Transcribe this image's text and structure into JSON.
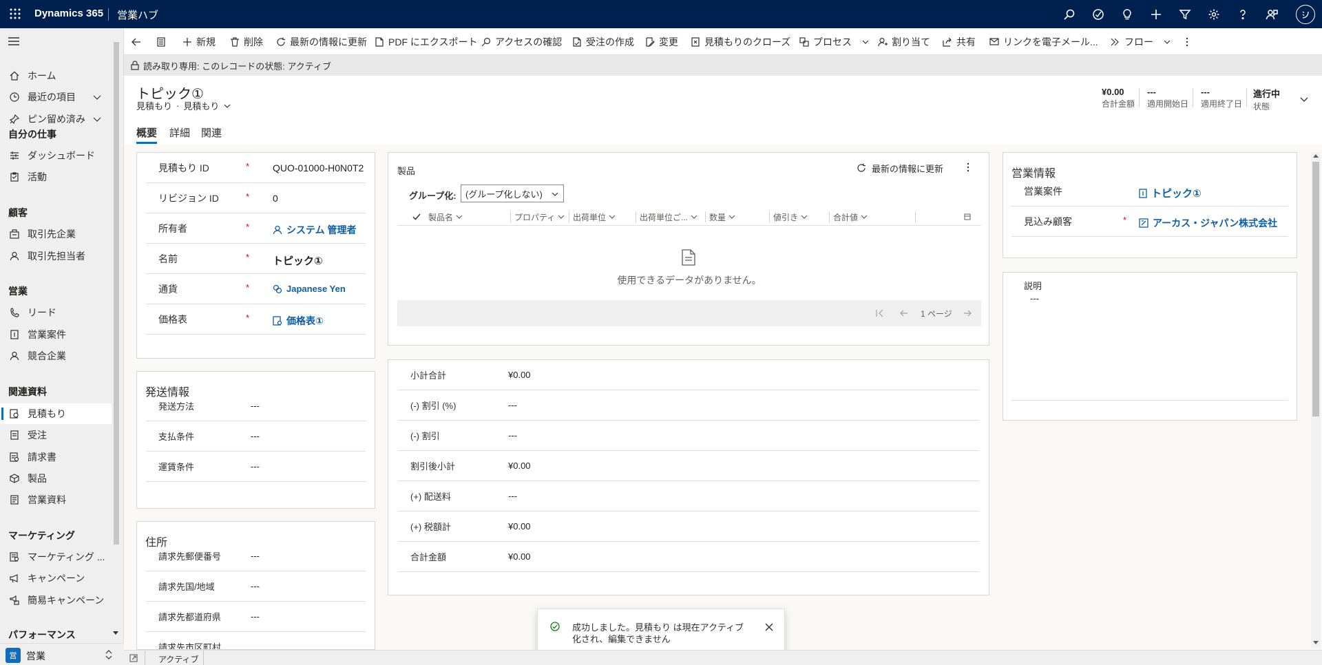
{
  "topbar": {
    "brand": "Dynamics 365",
    "app_name": "営業ハブ"
  },
  "nav": {
    "items": [
      {
        "label": "ホーム"
      },
      {
        "label": "最近の項目"
      },
      {
        "label": "ピン留め済み"
      }
    ],
    "groups": {
      "my_work": "自分の仕事",
      "customers": "顧客",
      "sales": "営業",
      "collateral": "関連資料",
      "marketing": "マーケティング",
      "performance": "パフォーマンス"
    },
    "my_work_items": [
      {
        "label": "ダッシュボード"
      },
      {
        "label": "活動"
      }
    ],
    "customer_items": [
      {
        "label": "取引先企業"
      },
      {
        "label": "取引先担当者"
      }
    ],
    "sales_items": [
      {
        "label": "リード"
      },
      {
        "label": "営業案件"
      },
      {
        "label": "競合企業"
      }
    ],
    "collateral_items": [
      {
        "label": "見積もり"
      },
      {
        "label": "受注"
      },
      {
        "label": "請求書"
      },
      {
        "label": "製品"
      },
      {
        "label": "営業資料"
      }
    ],
    "marketing_items": [
      {
        "label": "マーケティング ..."
      },
      {
        "label": "キャンペーン"
      },
      {
        "label": "簡易キャンペーン"
      }
    ],
    "area_label": "営業",
    "area_badge": "営"
  },
  "commands": {
    "new": "新規",
    "delete": "削除",
    "refresh": "最新の情報に更新",
    "pdf": "PDF にエクスポート",
    "access": "アクセスの確認",
    "create_order": "受注の作成",
    "revise": "変更",
    "close_quote": "見積もりのクローズ",
    "process": "プロセス",
    "assign": "割り当て",
    "share": "共有",
    "email_link": "リンクを電子メール...",
    "flow": "フロー"
  },
  "readonly_banner": "読み取り専用: このレコードの状態: アクティブ",
  "header": {
    "title": "トピック①",
    "entity": "見積もり",
    "form": "見積もり",
    "dot": "·",
    "fields": [
      {
        "value": "¥0.00",
        "label": "合計金額"
      },
      {
        "value": "---",
        "label": "適用開始日"
      },
      {
        "value": "---",
        "label": "適用終了日"
      },
      {
        "value": "進行中",
        "label": "状態"
      }
    ]
  },
  "tabs": [
    {
      "label": "概要"
    },
    {
      "label": "詳細"
    },
    {
      "label": "関連"
    }
  ],
  "main_fields": [
    {
      "label": "見積もり ID",
      "value": "QUO-01000-H0N0T2",
      "required": "*"
    },
    {
      "label": "リビジョン ID",
      "value": "0",
      "required": "*"
    },
    {
      "label": "所有者",
      "value": "システム 管理者",
      "required": "*"
    },
    {
      "label": "名前",
      "value": "トピック①",
      "required": "*"
    },
    {
      "label": "通貨",
      "value": "Japanese Yen",
      "required": "*"
    },
    {
      "label": "価格表",
      "value": "価格表①",
      "required": "*"
    }
  ],
  "shipping": {
    "title": "発送情報",
    "fields": [
      {
        "label": "発送方法",
        "value": "---"
      },
      {
        "label": "支払条件",
        "value": "---"
      },
      {
        "label": "運賃条件",
        "value": "---"
      }
    ]
  },
  "address": {
    "title": "住所",
    "fields": [
      {
        "label": "請求先郵便番号",
        "value": "---"
      },
      {
        "label": "請求先国/地域",
        "value": "---"
      },
      {
        "label": "請求先都道府県",
        "value": "---"
      },
      {
        "label": "請求先市区町村",
        "value": ""
      }
    ]
  },
  "products": {
    "title": "製品",
    "refresh": "最新の情報に更新",
    "group_by_label": "グループ化:",
    "group_by_value": "(グループ化しない)",
    "columns": [
      "製品名",
      "プロパティ",
      "出荷単位",
      "出荷単位ご...",
      "数量",
      "値引き",
      "合計値"
    ],
    "empty_message": "使用できるデータがありません。",
    "page_label": "1 ページ"
  },
  "summary": [
    {
      "label": "小計合計",
      "value": "¥0.00"
    },
    {
      "label": "(-) 割引 (%)",
      "value": "---"
    },
    {
      "label": "(-) 割引",
      "value": "---"
    },
    {
      "label": "割引後小計",
      "value": "¥0.00"
    },
    {
      "label": "(+) 配送料",
      "value": "---"
    },
    {
      "label": "(+) 税額計",
      "value": "¥0.00"
    },
    {
      "label": "合計金額",
      "value": "¥0.00"
    }
  ],
  "sales_info": {
    "title": "営業情報",
    "fields": [
      {
        "label": "営業案件",
        "value": "トピック①",
        "required": ""
      },
      {
        "label": "見込み顧客",
        "value": "アーカス・ジャパン株式会社",
        "required": "*"
      }
    ]
  },
  "description": {
    "label": "説明",
    "value": "---"
  },
  "toast": {
    "message": "成功しました。見積もり は現在アクティブ化され、編集できません"
  },
  "statusbar": {
    "status": "アクティブ"
  },
  "colors": {
    "topbar": "#002050",
    "link": "#115ea3",
    "required": "#c50f1f",
    "success": "#107c10",
    "accent": "#0f6cbd"
  }
}
